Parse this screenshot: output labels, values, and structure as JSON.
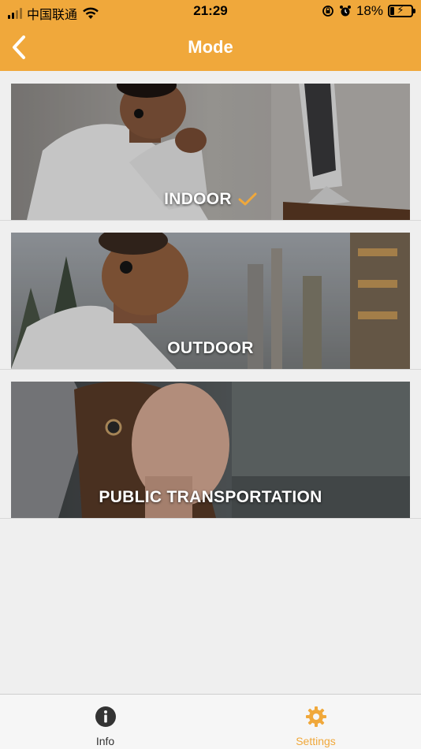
{
  "status_bar": {
    "carrier": "中国联通",
    "time": "21:29",
    "battery_percent": "18%",
    "battery_level": 0.18
  },
  "nav": {
    "title": "Mode",
    "back_icon": "chevron-left-icon"
  },
  "modes": [
    {
      "label": "INDOOR",
      "selected": true
    },
    {
      "label": "OUTDOOR",
      "selected": false
    },
    {
      "label": "PUBLIC TRANSPORTATION",
      "selected": false
    }
  ],
  "tabs": [
    {
      "label": "Info",
      "icon": "info-icon",
      "active": false
    },
    {
      "label": "Settings",
      "icon": "gear-icon",
      "active": true
    }
  ],
  "colors": {
    "accent": "#f0a83b",
    "background": "#efefef",
    "tab_inactive": "#333333"
  }
}
